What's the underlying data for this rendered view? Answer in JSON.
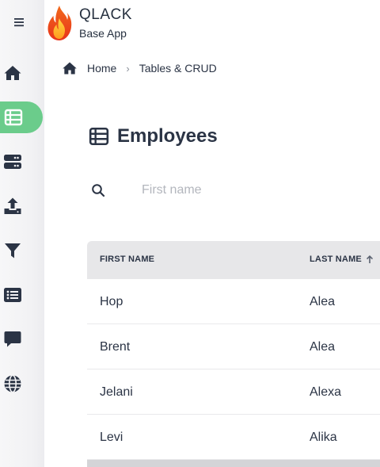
{
  "app": {
    "title": "QLACK",
    "subtitle": "Base App"
  },
  "sidebar": {
    "items": [
      {
        "icon": "home-icon",
        "name": "home"
      },
      {
        "icon": "table-icon",
        "name": "tables",
        "active": true
      },
      {
        "icon": "server-icon",
        "name": "server"
      },
      {
        "icon": "upload-icon",
        "name": "upload"
      },
      {
        "icon": "filter-icon",
        "name": "filter"
      },
      {
        "icon": "list-icon",
        "name": "list"
      },
      {
        "icon": "chat-icon",
        "name": "chat"
      },
      {
        "icon": "globe-icon",
        "name": "globe"
      }
    ],
    "active_color": "#6bcc8b"
  },
  "breadcrumb": {
    "home": "Home",
    "current": "Tables & CRUD"
  },
  "page": {
    "title": "Employees"
  },
  "search": {
    "placeholder": "First name",
    "value": ""
  },
  "table": {
    "headers": {
      "first_name": "FIRST NAME",
      "last_name": "LAST NAME"
    },
    "sort": {
      "column": "last_name",
      "direction": "ascending"
    },
    "rows": [
      {
        "first_name": "Hop",
        "last_name": "Alea"
      },
      {
        "first_name": "Brent",
        "last_name": "Alea"
      },
      {
        "first_name": "Jelani",
        "last_name": "Alexa"
      },
      {
        "first_name": "Levi",
        "last_name": "Alika"
      }
    ]
  }
}
